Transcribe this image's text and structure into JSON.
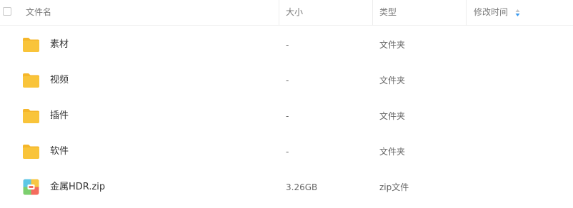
{
  "header": {
    "name_label": "文件名",
    "size_label": "大小",
    "type_label": "类型",
    "modified_label": "修改时间",
    "sort_icon": "sort-arrows-icon",
    "accent_color": "#3b9bf0"
  },
  "rows": [
    {
      "name": "素材",
      "size": "-",
      "type": "文件夹",
      "modified": "",
      "icon": "folder-icon"
    },
    {
      "name": "视频",
      "size": "-",
      "type": "文件夹",
      "modified": "",
      "icon": "folder-icon"
    },
    {
      "name": "插件",
      "size": "-",
      "type": "文件夹",
      "modified": "",
      "icon": "folder-icon"
    },
    {
      "name": "软件",
      "size": "-",
      "type": "文件夹",
      "modified": "",
      "icon": "folder-icon"
    },
    {
      "name": "金属HDR.zip",
      "size": "3.26GB",
      "type": "zip文件",
      "modified": "",
      "icon": "zip-archive-icon"
    }
  ],
  "colors": {
    "folder": "#f9c43a",
    "folder_tab": "#f5b62a"
  }
}
